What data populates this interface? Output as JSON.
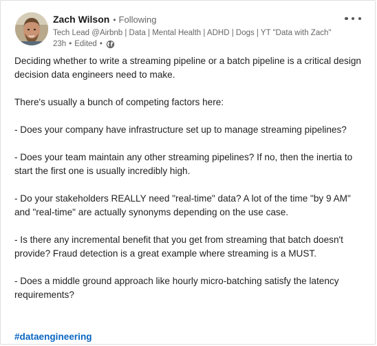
{
  "post": {
    "author": {
      "name": "Zach Wilson",
      "follow_status": "Following",
      "headline": "Tech Lead @Airbnb | Data | Mental Health | ADHD | Dogs | YT \"Data with Zach\"",
      "age": "23h",
      "edited": "Edited",
      "visibility_icon": "globe-icon"
    },
    "more_menu_icon": "ellipsis-icon",
    "paragraphs": [
      "Deciding whether to write a streaming pipeline or a batch pipeline is a critical design decision data engineers need to make.",
      "There's usually a bunch of competing factors here:",
      "- Does your company have infrastructure set up to manage streaming pipelines?",
      "- Does your team maintain any other streaming pipelines? If no, then the inertia to start the first one is usually incredibly high.",
      "- Do your stakeholders REALLY need \"real-time\" data? A lot of the time \"by 9 AM\" and \"real-time\" are actually synonyms depending on the use case.",
      "- Is there any incremental benefit that you get from streaming that batch doesn't provide? Fraud detection is a great example where streaming is a MUST.",
      "- Does a middle ground approach like hourly micro-batching satisfy the latency requirements?"
    ],
    "hashtag": "#dataengineering"
  },
  "colors": {
    "link": "#0a66c2",
    "text": "#1f1f1f",
    "secondary_text": "#666666",
    "border": "#dedede"
  }
}
